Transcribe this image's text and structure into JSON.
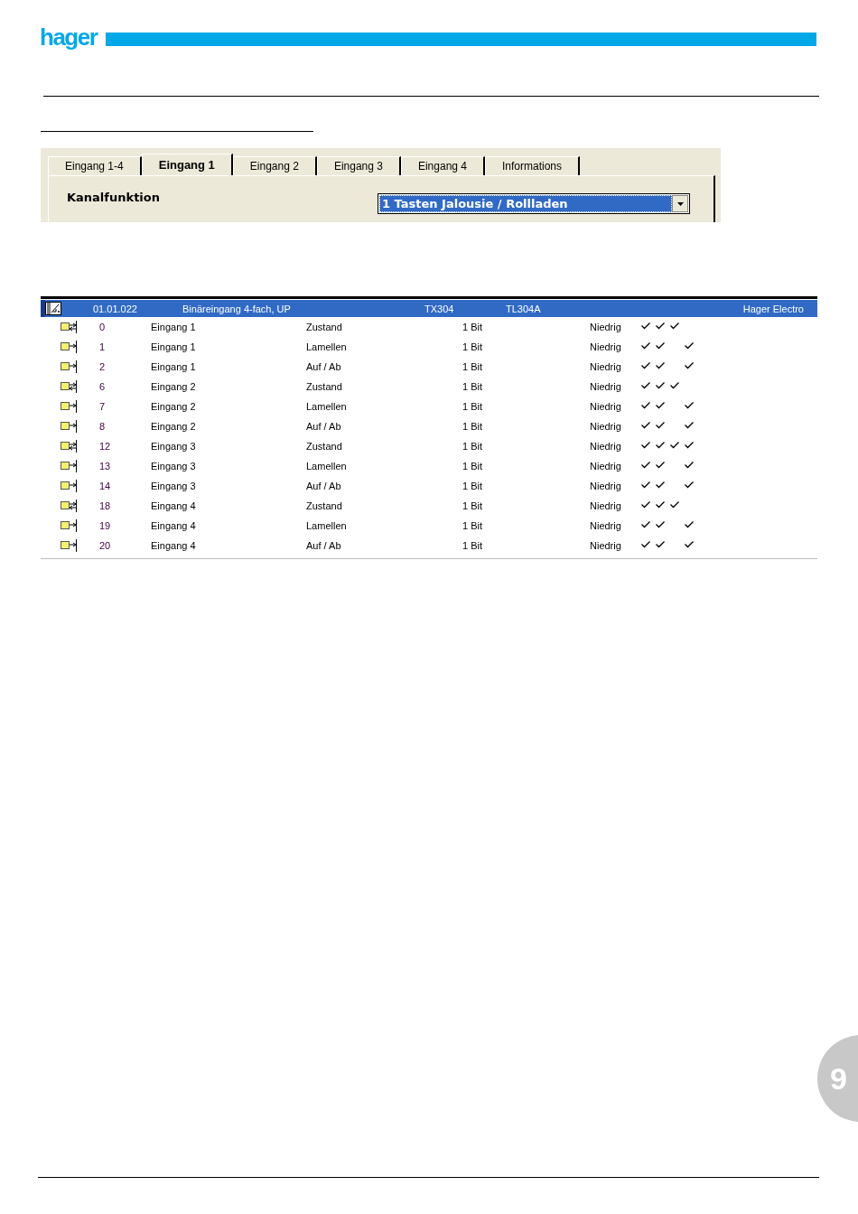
{
  "header": {
    "logo": "hager"
  },
  "dialog": {
    "tabs": [
      {
        "label": "Eingang 1-4",
        "selected": false
      },
      {
        "label": "Eingang 1",
        "selected": true
      },
      {
        "label": "Eingang 2",
        "selected": false
      },
      {
        "label": "Eingang 3",
        "selected": false
      },
      {
        "label": "Eingang 4",
        "selected": false
      },
      {
        "label": "Informations",
        "selected": false
      }
    ],
    "field_label": "Kanalfunktion",
    "dropdown_value": "1 Tasten Jalousie / Rollladen"
  },
  "device": {
    "address": "01.01.022",
    "name": "Binäreingang 4-fach, UP",
    "product": "TX304",
    "application": "TL304A",
    "manufacturer": "Hager Electro"
  },
  "objects": [
    {
      "kind": "in-out",
      "number": "0",
      "name": "Eingang 1",
      "function": "Zustand",
      "size": "1 Bit",
      "priority": "Niedrig",
      "flags": [
        true,
        true,
        true,
        false
      ]
    },
    {
      "kind": "out",
      "number": "1",
      "name": "Eingang 1",
      "function": "Lamellen",
      "size": "1 Bit",
      "priority": "Niedrig",
      "flags": [
        true,
        true,
        false,
        true
      ]
    },
    {
      "kind": "out",
      "number": "2",
      "name": "Eingang 1",
      "function": "Auf / Ab",
      "size": "1 Bit",
      "priority": "Niedrig",
      "flags": [
        true,
        true,
        false,
        true
      ]
    },
    {
      "kind": "in-out",
      "number": "6",
      "name": "Eingang 2",
      "function": "Zustand",
      "size": "1 Bit",
      "priority": "Niedrig",
      "flags": [
        true,
        true,
        true,
        false
      ]
    },
    {
      "kind": "out",
      "number": "7",
      "name": "Eingang 2",
      "function": "Lamellen",
      "size": "1 Bit",
      "priority": "Niedrig",
      "flags": [
        true,
        true,
        false,
        true
      ]
    },
    {
      "kind": "out",
      "number": "8",
      "name": "Eingang 2",
      "function": "Auf / Ab",
      "size": "1 Bit",
      "priority": "Niedrig",
      "flags": [
        true,
        true,
        false,
        true
      ]
    },
    {
      "kind": "in-out",
      "number": "12",
      "name": "Eingang 3",
      "function": "Zustand",
      "size": "1 Bit",
      "priority": "Niedrig",
      "flags": [
        true,
        true,
        true,
        true
      ]
    },
    {
      "kind": "out",
      "number": "13",
      "name": "Eingang 3",
      "function": "Lamellen",
      "size": "1 Bit",
      "priority": "Niedrig",
      "flags": [
        true,
        true,
        false,
        true
      ]
    },
    {
      "kind": "out",
      "number": "14",
      "name": "Eingang 3",
      "function": "Auf / Ab",
      "size": "1 Bit",
      "priority": "Niedrig",
      "flags": [
        true,
        true,
        false,
        true
      ]
    },
    {
      "kind": "in-out",
      "number": "18",
      "name": "Eingang 4",
      "function": "Zustand",
      "size": "1 Bit",
      "priority": "Niedrig",
      "flags": [
        true,
        true,
        true,
        false
      ]
    },
    {
      "kind": "out",
      "number": "19",
      "name": "Eingang 4",
      "function": "Lamellen",
      "size": "1 Bit",
      "priority": "Niedrig",
      "flags": [
        true,
        true,
        false,
        true
      ]
    },
    {
      "kind": "out",
      "number": "20",
      "name": "Eingang 4",
      "function": "Auf / Ab",
      "size": "1 Bit",
      "priority": "Niedrig",
      "flags": [
        true,
        true,
        false,
        true
      ]
    }
  ],
  "page_number": "9"
}
